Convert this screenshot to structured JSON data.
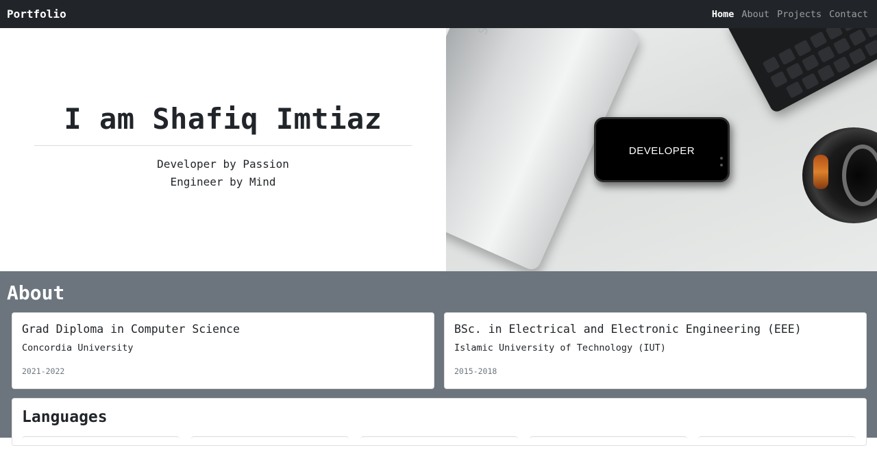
{
  "navbar": {
    "brand": "Portfolio",
    "links": [
      {
        "label": "Home",
        "active": true
      },
      {
        "label": "About",
        "active": false
      },
      {
        "label": "Projects",
        "active": false
      },
      {
        "label": "Contact",
        "active": false
      }
    ]
  },
  "hero": {
    "title": "I am Shafiq Imtiaz",
    "lines": [
      "Developer by Passion",
      "Engineer by Mind"
    ],
    "image": {
      "phone_text": "DEVELOPER",
      "laptop_logo": "ASUS"
    }
  },
  "about": {
    "heading": "About",
    "education": [
      {
        "title": "Grad Diploma in Computer Science",
        "institution": "Concordia University",
        "years": "2021-2022"
      },
      {
        "title": "BSc. in Electrical and Electronic Engineering (EEE)",
        "institution": "Islamic University of Technology (IUT)",
        "years": "2015-2018"
      }
    ],
    "languages_heading": "Languages"
  },
  "colors": {
    "navbar": "#212529",
    "about_bg": "#6c757d",
    "text": "#212529"
  }
}
